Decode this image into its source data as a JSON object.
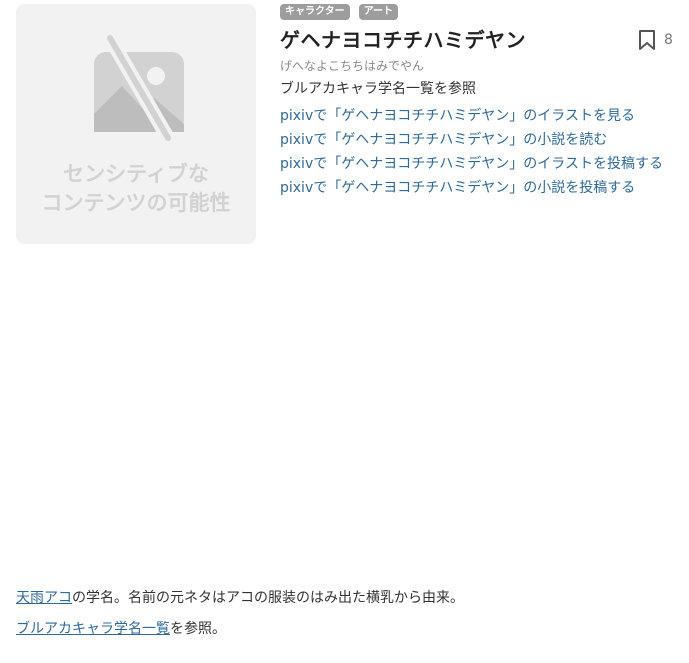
{
  "thumbnail": {
    "icon": "hidden-image-icon",
    "sensitive_line1": "センシティブな",
    "sensitive_line2": "コンテンツの可能性"
  },
  "tags": [
    "キャラクター",
    "アート"
  ],
  "title": "ゲヘナヨコチチハミデヤン",
  "bookmark": {
    "icon": "bookmark-icon",
    "count": "8"
  },
  "reading": "げへなよこちちはみでやん",
  "list_link": "ブルアカキャラ学名一覧を参照",
  "pixiv_links": [
    "pixivで「ゲヘナヨコチチハミデヤン」のイラストを見る",
    "pixivで「ゲヘナヨコチチハミデヤン」の小説を読む",
    "pixivで「ゲヘナヨコチチハミデヤン」のイラストを投稿する",
    "pixivで「ゲヘナヨコチチハミデヤン」の小説を投稿する"
  ],
  "body": {
    "p1_link": "天雨アコ",
    "p1_text": "の学名。名前の元ネタはアコの服装のはみ出た横乳から由来。",
    "p2_link": "ブルアカキャラ学名一覧",
    "p2_text": "を参照。"
  }
}
